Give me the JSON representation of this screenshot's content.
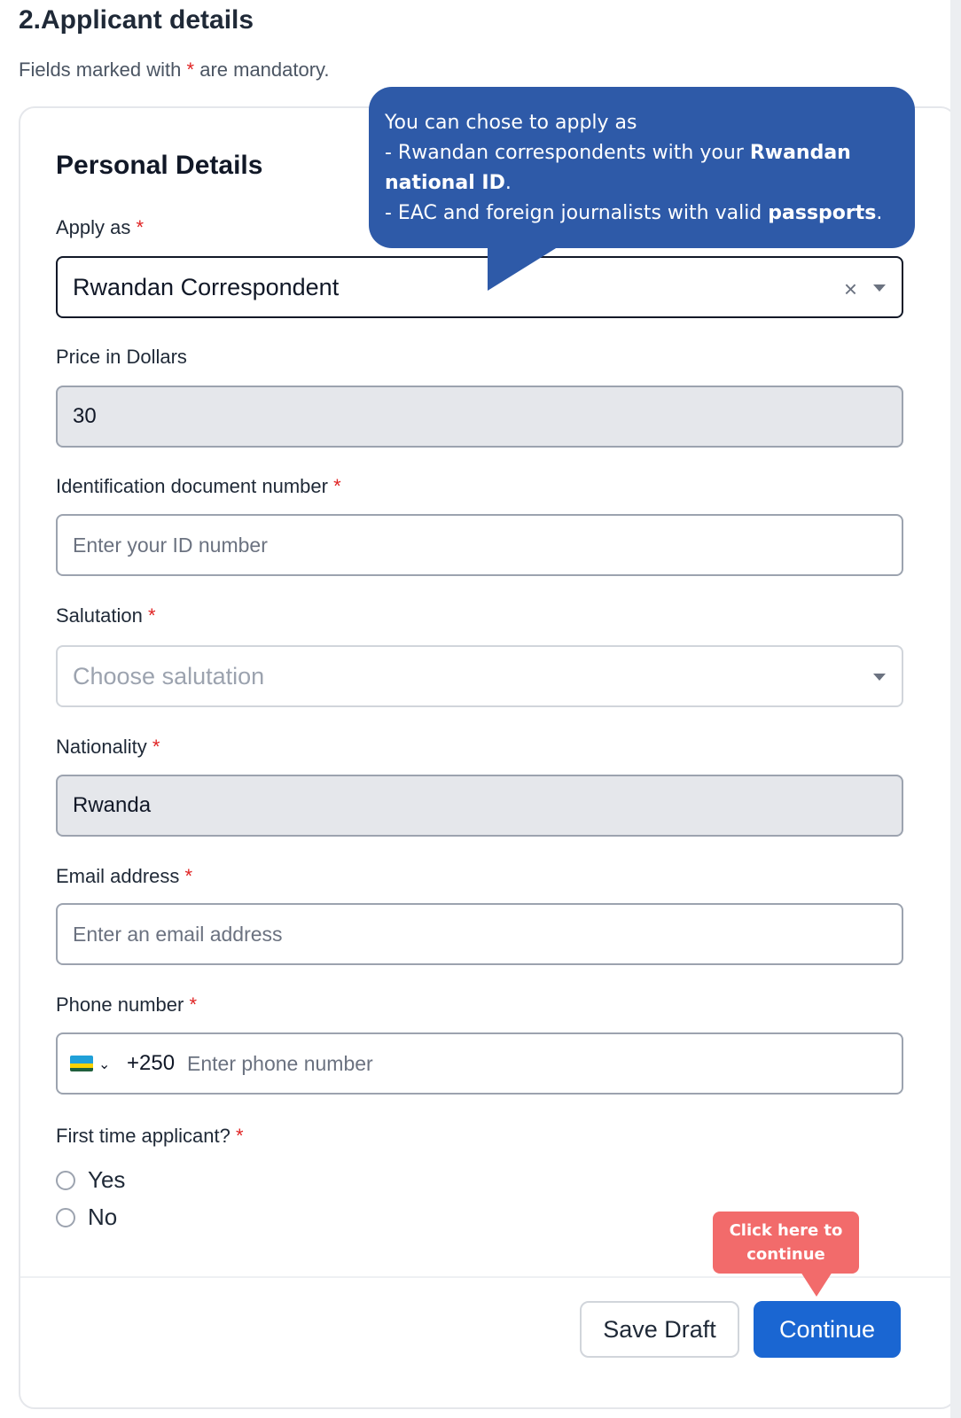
{
  "header": {
    "title": "2.Applicant details",
    "mandatory_prefix": "Fields marked with",
    "mandatory_star": "*",
    "mandatory_suffix": "are mandatory."
  },
  "card": {
    "title": "Personal Details"
  },
  "fields": {
    "apply_as": {
      "label": "Apply as",
      "value": "Rwandan Correspondent",
      "clear_symbol": "×"
    },
    "price": {
      "label": "Price in Dollars",
      "value": "30"
    },
    "id_number": {
      "label": "Identification document number",
      "placeholder": "Enter your ID number"
    },
    "salutation": {
      "label": "Salutation",
      "placeholder": "Choose salutation"
    },
    "nationality": {
      "label": "Nationality",
      "value": "Rwanda"
    },
    "email": {
      "label": "Email address",
      "placeholder": "Enter an email address"
    },
    "phone": {
      "label": "Phone number",
      "dial_code": "+250",
      "placeholder": "Enter phone number",
      "flag_icon": "rwanda-flag-icon",
      "chevron": "⌄"
    },
    "first_time": {
      "label": "First time applicant?",
      "options": [
        "Yes",
        "No"
      ]
    }
  },
  "required_star": "*",
  "buttons": {
    "save_draft": "Save Draft",
    "continue": "Continue"
  },
  "tooltips": {
    "apply_hint": {
      "line1": "You can chose to apply as",
      "line2_prefix": "- Rwandan correspondents with your ",
      "line2_bold": "Rwandan national ID",
      "line2_suffix": ".",
      "line3_prefix": "- EAC and foreign journalists with valid ",
      "line3_bold": "passports",
      "line3_suffix": "."
    },
    "continue_hint": {
      "line1": "Click here to",
      "line2": "continue"
    }
  },
  "colors": {
    "primary": "#1a66d2",
    "tooltip_blue": "#2e5aa8",
    "tooltip_red": "#f26b6b",
    "required": "#e02424"
  }
}
